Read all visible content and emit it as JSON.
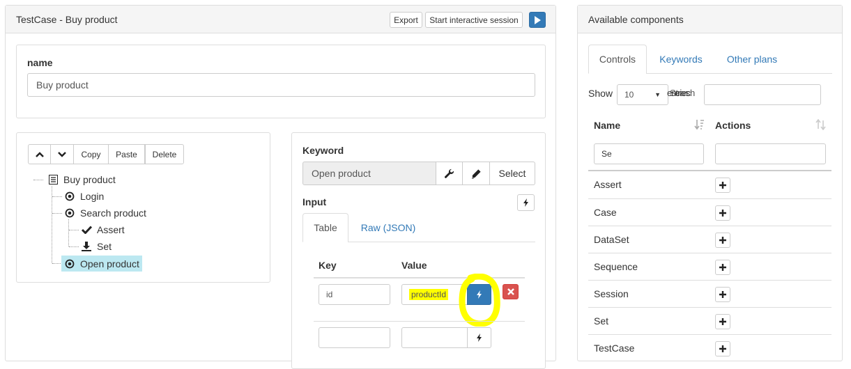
{
  "left_panel": {
    "title": "TestCase - Buy product",
    "export_label": "Export",
    "interactive_label": "Start interactive session"
  },
  "name_section": {
    "label": "name",
    "value": "Buy product"
  },
  "tree_toolbar": {
    "copy": "Copy",
    "paste": "Paste",
    "delete": "Delete"
  },
  "tree": {
    "root": "Buy product",
    "login": "Login",
    "search": "Search product",
    "assert": "Assert",
    "set": "Set",
    "open": "Open product"
  },
  "keyword": {
    "label": "Keyword",
    "value": "Open product",
    "select_label": "Select"
  },
  "input": {
    "label": "Input",
    "tabs": [
      "Table",
      "Raw (JSON)"
    ],
    "headers": [
      "Key",
      "Value"
    ],
    "rows": [
      {
        "key": "id",
        "value": "productId"
      },
      {
        "key": "",
        "value": ""
      }
    ]
  },
  "right_panel": {
    "title": "Available components",
    "tabs": [
      "Controls",
      "Keywords",
      "Other plans"
    ],
    "show_label": "Show",
    "page_size": "10",
    "entries_overlap": "Search",
    "entries_overlap2": "entries",
    "col_name": "Name",
    "col_actions": "Actions",
    "name_filter": "Se",
    "items": [
      "Assert",
      "Case",
      "DataSet",
      "Sequence",
      "Session",
      "Set",
      "TestCase"
    ]
  },
  "colors": {
    "primary": "#337ab7",
    "danger": "#d9534f",
    "highlight": "#ffff00",
    "selected_bg": "#bce8f1"
  }
}
